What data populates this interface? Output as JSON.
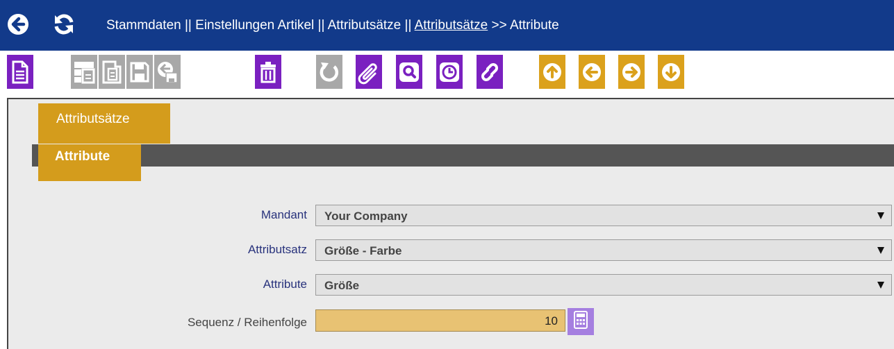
{
  "breadcrumb": {
    "prefix": "Stammdaten || Einstellungen Artikel || Attributsätze  ||",
    "link": "Attributsätze",
    "suffix": ">> Attribute"
  },
  "toolbar": {
    "buttons": [
      {
        "icon": "new-document-icon",
        "color": "#7a20c0",
        "enabled": true
      },
      {
        "icon": "multi-row-view-icon",
        "color": "#a8a8a8",
        "enabled": false
      },
      {
        "icon": "copy-record-icon",
        "color": "#a8a8a8",
        "enabled": false
      },
      {
        "icon": "save-icon",
        "color": "#a8a8a8",
        "enabled": false
      },
      {
        "icon": "save-and-new-icon",
        "color": "#a8a8a8",
        "enabled": false
      },
      {
        "icon": "delete-icon",
        "color": "#7a20c0",
        "enabled": true
      },
      {
        "icon": "undo-icon",
        "color": "#a8a8a8",
        "enabled": false
      },
      {
        "icon": "attachment-icon",
        "color": "#7a20c0",
        "enabled": true
      },
      {
        "icon": "search-icon",
        "color": "#7a20c0",
        "enabled": true
      },
      {
        "icon": "history-icon",
        "color": "#7a20c0",
        "enabled": true
      },
      {
        "icon": "link-icon",
        "color": "#7a20c0",
        "enabled": true
      },
      {
        "icon": "first-record-icon",
        "color": "#dba11c",
        "enabled": true
      },
      {
        "icon": "previous-record-icon",
        "color": "#dba11c",
        "enabled": true
      },
      {
        "icon": "next-record-icon",
        "color": "#dba11c",
        "enabled": true
      },
      {
        "icon": "last-record-icon",
        "color": "#dba11c",
        "enabled": true
      }
    ]
  },
  "tabs": {
    "parent": "Attributsätze",
    "active": "Attribute"
  },
  "form": {
    "mandant": {
      "label": "Mandant",
      "value": "Your Company"
    },
    "attributsatz": {
      "label": "Attributsatz",
      "value": "Größe - Farbe"
    },
    "attribute": {
      "label": "Attribute",
      "value": "Größe"
    },
    "sequenz": {
      "label": "Sequenz / Reihenfolge",
      "value": "10"
    }
  },
  "colors": {
    "header": "#123a8a",
    "accent_gold": "#d49c1c",
    "accent_purple": "#7a20c0",
    "disabled_gray": "#a8a8a8",
    "label_blue": "#28327c",
    "input_highlight": "#e8c273"
  }
}
